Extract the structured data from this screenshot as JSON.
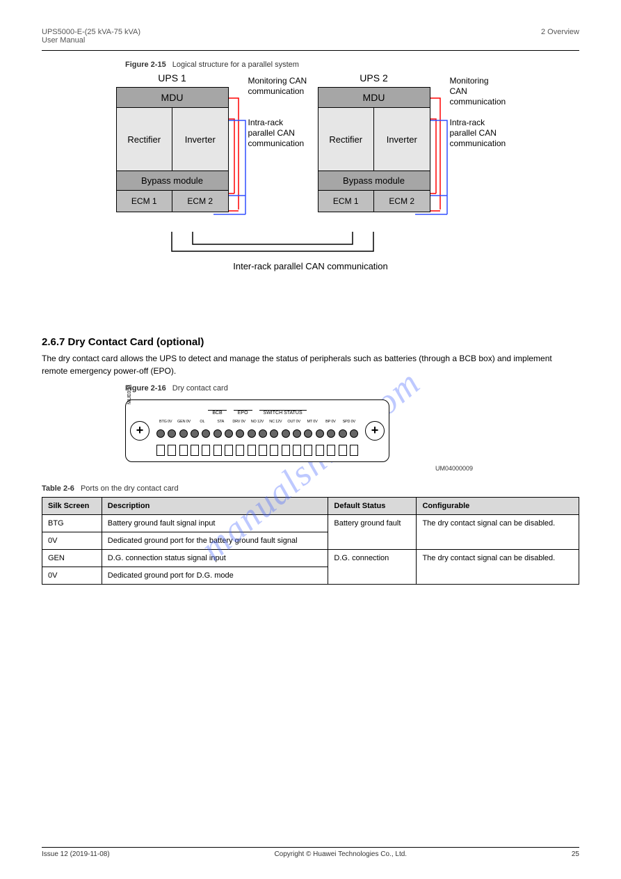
{
  "header": {
    "left": "UPS5000-E-(25 kVA-75 kVA)\nUser Manual",
    "right": "2 Overview"
  },
  "figure1": {
    "captionNum": "Figure 2-15",
    "captionText": "Logical structure for a parallel system",
    "ups1": "UPS 1",
    "ups2": "UPS 2",
    "mdu": "MDU",
    "rectifier": "Rectifier",
    "inverter": "Inverter",
    "bypass": "Bypass module",
    "ecm1": "ECM 1",
    "ecm2": "ECM 2",
    "note_mon": "Monitoring CAN\ncommunication",
    "note_intra": "Intra-rack\nparallel CAN\ncommunication",
    "inter_label": "Inter-rack parallel CAN communication"
  },
  "section": {
    "heading": "2.6.7 Dry Contact Card (optional)",
    "para": "The dry contact card allows the UPS to detect and manage the status of peripherals such as batteries (through a BCB box) and implement remote emergency power-off (EPO)."
  },
  "figure2": {
    "captionNum": "Figure 2-16",
    "captionText": "Dry contact card",
    "code": "UM04000009",
    "mue": "MUE05A",
    "group1": "BCB",
    "group2": "EPO",
    "group3": "SWITCH STATUS",
    "pins": [
      "BTG 0V",
      "GEN 0V",
      "OL",
      "STA",
      "DRV 0V",
      "NO 12V",
      "NC 12V",
      "OUT 0V",
      "MT 0V",
      "BP  0V",
      "SPD 0V"
    ]
  },
  "table": {
    "captionNum": "Table 2-6",
    "captionText": "Ports on the dry contact card",
    "columns": [
      "Silk Screen",
      "Description",
      "Default Status",
      "Configurable"
    ],
    "rows": [
      [
        "BTG",
        "Battery ground fault signal input",
        "Battery ground fault",
        "The dry contact signal can be disabled."
      ],
      [
        "0V",
        "Dedicated ground port for the battery ground fault signal",
        "",
        ""
      ],
      [
        "GEN",
        "D.G. connection status signal input",
        "D.G. connection",
        "The dry contact signal can be disabled."
      ],
      [
        "0V",
        "Dedicated ground port for D.G. mode",
        "",
        ""
      ]
    ]
  },
  "footer": {
    "left": "Issue 12 (2019-11-08)",
    "center": "Copyright © Huawei Technologies Co., Ltd.",
    "right": "25"
  },
  "watermark": "manualshive.com"
}
